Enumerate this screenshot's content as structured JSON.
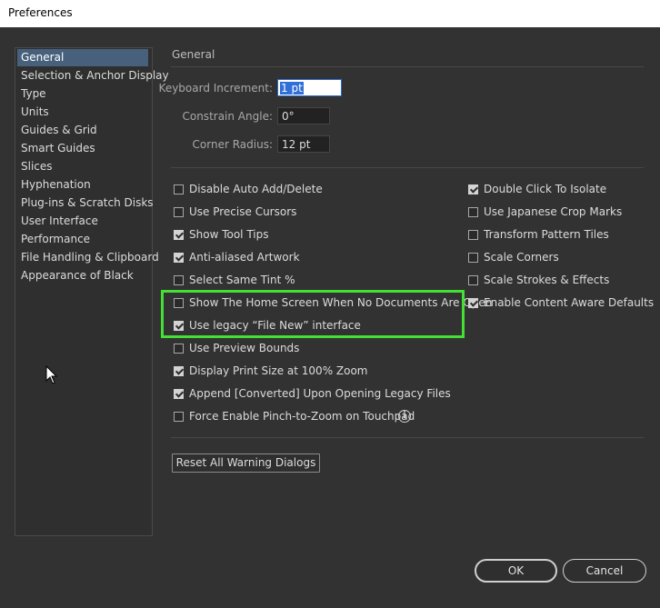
{
  "window": {
    "title": "Preferences"
  },
  "sidebar": {
    "items": [
      {
        "label": "General",
        "selected": true
      },
      {
        "label": "Selection & Anchor Display"
      },
      {
        "label": "Type"
      },
      {
        "label": "Units"
      },
      {
        "label": "Guides & Grid"
      },
      {
        "label": "Smart Guides"
      },
      {
        "label": "Slices"
      },
      {
        "label": "Hyphenation"
      },
      {
        "label": "Plug-ins & Scratch Disks"
      },
      {
        "label": "User Interface"
      },
      {
        "label": "Performance"
      },
      {
        "label": "File Handling & Clipboard"
      },
      {
        "label": "Appearance of Black"
      }
    ]
  },
  "general": {
    "title": "General",
    "keyboard_increment": {
      "label": "Keyboard Increment:",
      "value": "1 pt"
    },
    "constrain_angle": {
      "label": "Constrain Angle:",
      "value": "0°"
    },
    "corner_radius": {
      "label": "Corner Radius:",
      "value": "12 pt"
    },
    "left_options": [
      {
        "label": "Disable Auto Add/Delete",
        "checked": false
      },
      {
        "label": "Use Precise Cursors",
        "checked": false
      },
      {
        "label": "Show Tool Tips",
        "checked": true
      },
      {
        "label": "Anti-aliased Artwork",
        "checked": true
      },
      {
        "label": "Select Same Tint %",
        "checked": false
      },
      {
        "label": "Show The Home Screen When No Documents Are Open",
        "checked": false
      },
      {
        "label": "Use legacy “File New” interface",
        "checked": true
      },
      {
        "label": "Use Preview Bounds",
        "checked": false
      },
      {
        "label": "Display Print Size at 100% Zoom",
        "checked": true
      },
      {
        "label": "Append [Converted] Upon Opening Legacy Files",
        "checked": true
      },
      {
        "label": "Force Enable Pinch-to-Zoom on Touchpad",
        "checked": false
      }
    ],
    "right_options": [
      {
        "label": "Double Click To Isolate",
        "checked": true
      },
      {
        "label": "Use Japanese Crop Marks",
        "checked": false
      },
      {
        "label": "Transform Pattern Tiles",
        "checked": false
      },
      {
        "label": "Scale Corners",
        "checked": false
      },
      {
        "label": "Scale Strokes & Effects",
        "checked": false
      },
      {
        "label": "Enable Content Aware Defaults",
        "checked": true
      }
    ],
    "reset_button": "Reset All Warning Dialogs",
    "info_icon": "info-icon",
    "highlight_color": "#44e034"
  },
  "footer": {
    "ok_label": "OK",
    "cancel_label": "Cancel"
  }
}
